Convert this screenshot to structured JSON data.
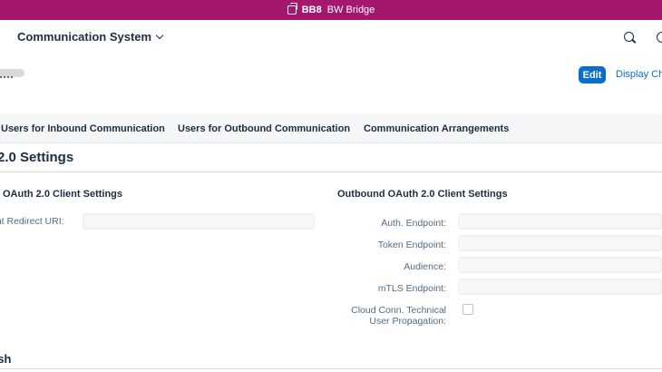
{
  "topbar": {
    "system_id": "BB8",
    "system_name": "BW Bridge",
    "color": "#a3176e"
  },
  "shell": {
    "app_title": "Communication System"
  },
  "header": {
    "edit_label": "Edit",
    "display_label": "Display Ch"
  },
  "tabs": [
    {
      "label": "Users for Inbound Communication"
    },
    {
      "label": "Users for Outbound Communication"
    },
    {
      "label": "Communication Arrangements"
    }
  ],
  "section": {
    "title": "2.0 Settings"
  },
  "inbound": {
    "title": "OAuth 2.0 Client Settings",
    "fields": [
      {
        "label": "ent Redirect URI:",
        "value": ""
      }
    ]
  },
  "outbound": {
    "title": "Outbound OAuth 2.0 Client Settings",
    "fields": [
      {
        "label": "Auth. Endpoint:",
        "value": ""
      },
      {
        "label": "Token Endpoint:",
        "value": ""
      },
      {
        "label": "Audience:",
        "value": ""
      },
      {
        "label": "mTLS Endpoint:",
        "value": ""
      }
    ],
    "checkbox_label_line1": "Cloud Conn. Technical",
    "checkbox_label_line2": "User Propagation:"
  },
  "refresh": {
    "title": "esh"
  },
  "colors": {
    "accent": "#0a6ed1",
    "text": "#1d2d3e",
    "label": "#556b82"
  }
}
